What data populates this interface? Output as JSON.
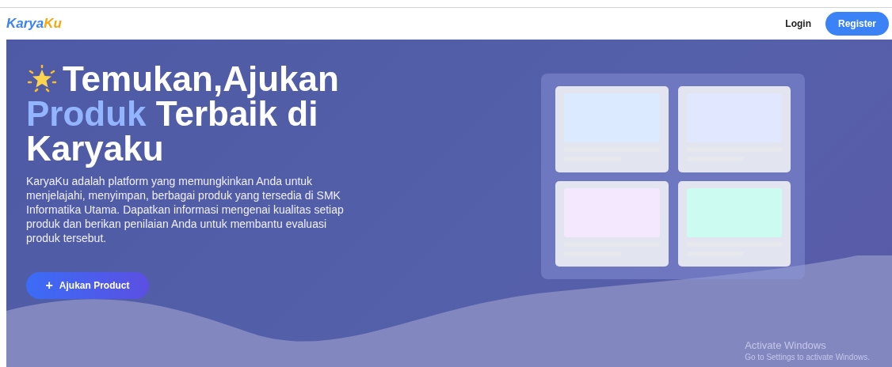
{
  "nav": {
    "brand_first": "Karya",
    "brand_second": "Ku",
    "login": "Login",
    "register": "Register"
  },
  "hero": {
    "headline": [
      [
        {
          "text": "Temukan,Ajukan",
          "highlight": false
        }
      ],
      [
        {
          "text": "Produk",
          "highlight": true
        },
        {
          "text": " Terbaik di",
          "highlight": false
        }
      ],
      [
        {
          "text": "Karyaku",
          "highlight": false
        }
      ]
    ],
    "description": "KaryaKu adalah platform yang memungkinkan Anda untuk menjelajahi, menyimpan, berbagai produk yang tersedia di SMK Informatika Utama. Dapatkan informasi mengenai kualitas setiap produk dan berikan penilaian Anda untuk membantu evaluasi produk tersebut.",
    "cta": {
      "icon": "+",
      "label": "Ajukan Product"
    },
    "preview_cards": [
      {
        "color": "#dbeafe"
      },
      {
        "color": "#e0e7ff"
      },
      {
        "color": "#f3e8ff"
      },
      {
        "color": "#ccfbf1"
      }
    ]
  },
  "os_notice": {
    "title": "Activate Windows",
    "subtitle": "Go to Settings to activate Windows."
  }
}
